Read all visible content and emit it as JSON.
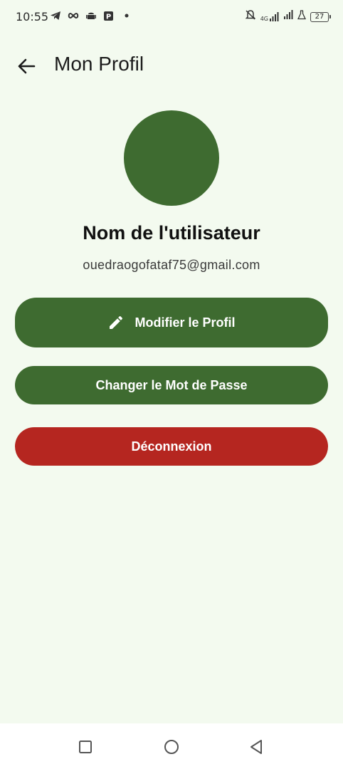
{
  "status_bar": {
    "time": "10:55",
    "network": "4G",
    "battery": "27",
    "left_icons": [
      "telegram-icon",
      "infinity-icon",
      "android-icon",
      "parking-icon",
      "dot-icon"
    ],
    "right_icons": [
      "silent-bell-icon",
      "signal-icon",
      "signal-icon",
      "flask-icon",
      "battery-icon"
    ]
  },
  "app_bar": {
    "title": "Mon Profil",
    "back_icon": "arrow-left-icon"
  },
  "profile": {
    "avatar_color": "#3e6b30",
    "name": "Nom de l'utilisateur",
    "email": "ouedraogofataf75@gmail.com"
  },
  "actions": {
    "edit_label": "Modifier le Profil",
    "edit_icon": "pencil-icon",
    "password_label": "Changer le Mot de Passe",
    "logout_label": "Déconnexion"
  },
  "colors": {
    "background": "#f3faef",
    "primary": "#3e6b30",
    "danger": "#b52620"
  },
  "nav_bar": {
    "icons": [
      "recent-apps-icon",
      "home-icon",
      "back-icon"
    ]
  }
}
